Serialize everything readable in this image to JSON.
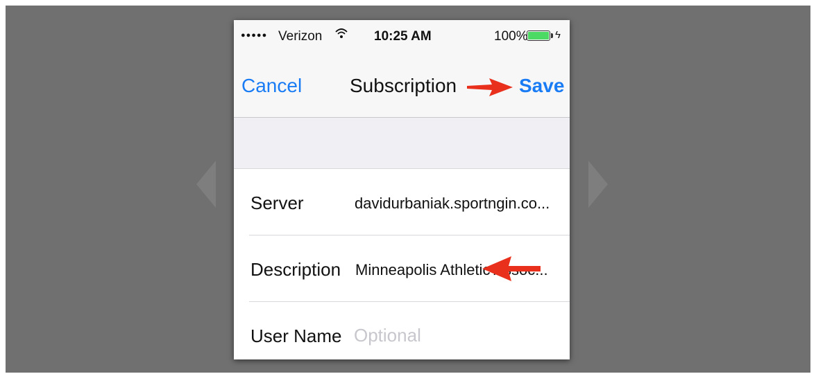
{
  "status_bar": {
    "carrier": "Verizon",
    "time": "10:25 AM",
    "battery": "100%",
    "battery_level": 1.0
  },
  "navbar": {
    "cancel_label": "Cancel",
    "title": "Subscription",
    "save_label": "Save"
  },
  "form": {
    "rows": [
      {
        "label": "Server",
        "value": "davidurbaniak.sportngin.co..."
      },
      {
        "label": "Description",
        "value": "Minneapolis Athletic Assoc..."
      },
      {
        "label": "User Name",
        "placeholder": "Optional",
        "value": ""
      }
    ]
  },
  "colors": {
    "accent": "#1a7cf4",
    "annotation_arrow": "#e8301c",
    "battery": "#4cd964"
  },
  "icons": [
    "signal-dots-icon",
    "wifi-icon",
    "battery-icon",
    "charging-bolt-icon",
    "annotation-arrow-icon"
  ]
}
